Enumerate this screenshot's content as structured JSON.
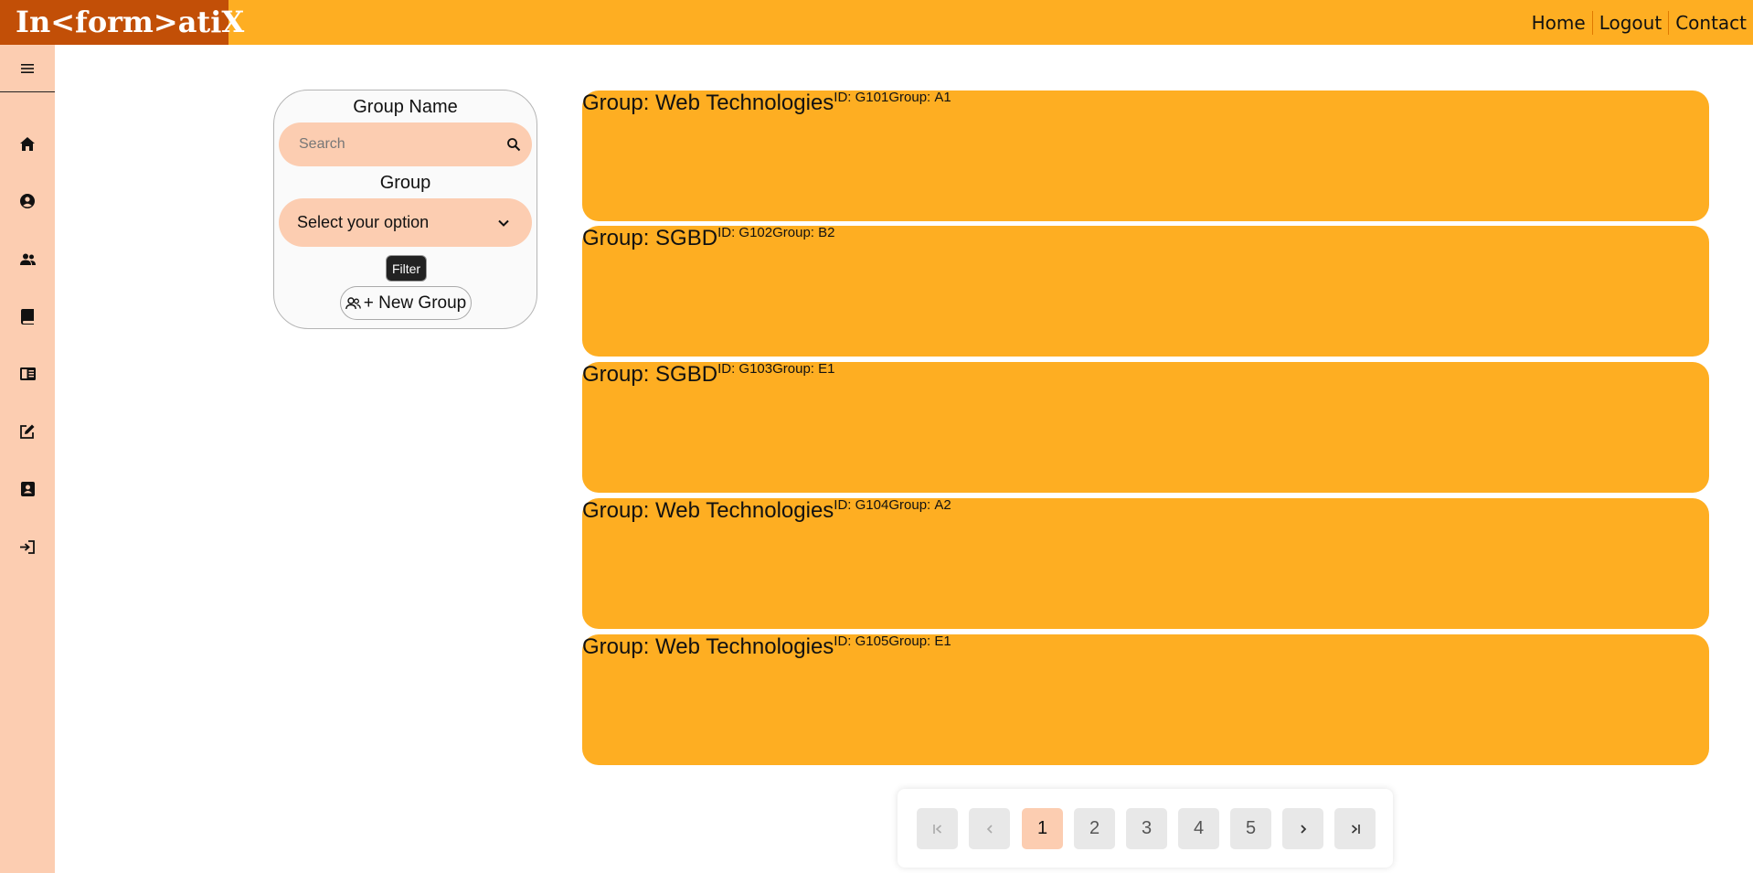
{
  "app": {
    "brand": "In<form>atiX",
    "nav": [
      {
        "label": "Home"
      },
      {
        "label": "Logout"
      },
      {
        "label": "Contact"
      }
    ]
  },
  "sidebar": {
    "items": [
      {
        "icon": "home-icon"
      },
      {
        "icon": "user-circle-icon"
      },
      {
        "icon": "users-icon"
      },
      {
        "icon": "book-icon"
      },
      {
        "icon": "book-open-icon"
      },
      {
        "icon": "edit-icon"
      },
      {
        "icon": "contact-card-icon"
      },
      {
        "icon": "login-icon"
      }
    ]
  },
  "filter": {
    "name_label": "Group Name",
    "search_placeholder": "Search",
    "group_label": "Group",
    "select_value": "Select your option",
    "filter_button": "Filter",
    "new_group_button": "+ New Group"
  },
  "groups": [
    {
      "title": "Group: Web Technologies",
      "id_label": "ID: ",
      "id": "G101",
      "group_label": "Group: ",
      "group": "A1"
    },
    {
      "title": "Group: SGBD",
      "id_label": "ID: ",
      "id": "G102",
      "group_label": "Group: ",
      "group": "B2"
    },
    {
      "title": "Group: SGBD",
      "id_label": "ID: ",
      "id": "G103",
      "group_label": "Group: ",
      "group": "E1"
    },
    {
      "title": "Group: Web Technologies",
      "id_label": "ID: ",
      "id": "G104",
      "group_label": "Group: ",
      "group": "A2"
    },
    {
      "title": "Group: Web Technologies",
      "id_label": "ID: ",
      "id": "G105",
      "group_label": "Group: ",
      "group": "E1"
    }
  ],
  "pagination": {
    "pages": [
      "1",
      "2",
      "3",
      "4",
      "5"
    ],
    "current": "1"
  },
  "colors": {
    "header": "#feae22",
    "brand": "#c24f07",
    "sidebar": "#fccdb1",
    "card": "#feae22",
    "active_page": "#fccdb1"
  }
}
